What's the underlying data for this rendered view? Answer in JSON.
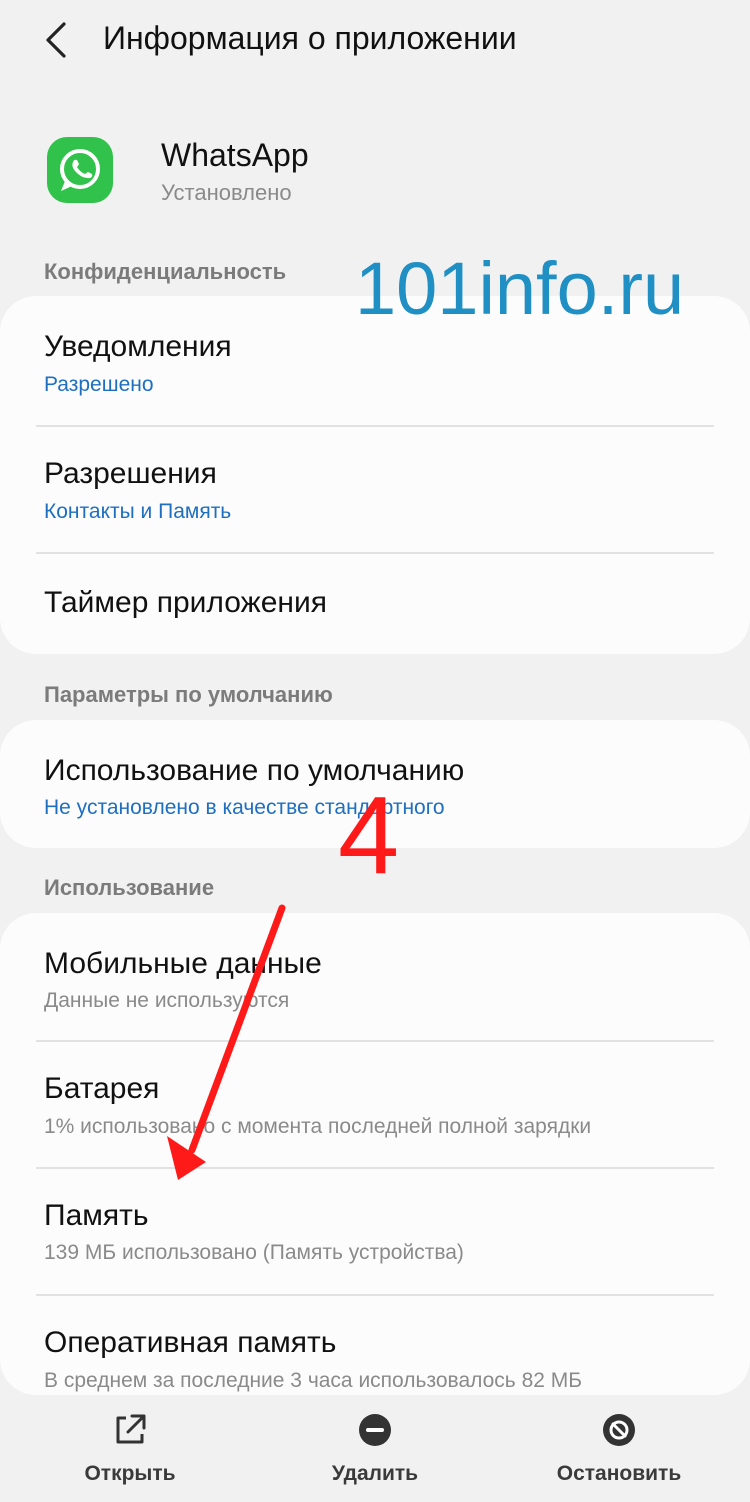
{
  "header": {
    "title": "Информация о приложении"
  },
  "app": {
    "name": "WhatsApp",
    "status": "Установлено"
  },
  "sections": {
    "privacy": "Конфиденциальность",
    "defaults": "Параметры по умолчанию",
    "usage": "Использование"
  },
  "privacy_items": [
    {
      "title": "Уведомления",
      "subtitle": "Разрешено"
    },
    {
      "title": "Разрешения",
      "subtitle": "Контакты и Память"
    },
    {
      "title": "Таймер приложения"
    }
  ],
  "defaults_items": [
    {
      "title": "Использование по умолчанию",
      "subtitle": "Не установлено в качестве стандартного"
    }
  ],
  "usage_items": [
    {
      "title": "Мобильные данные",
      "subtitle": "Данные не используются"
    },
    {
      "title": "Батарея",
      "subtitle": "1% использовано с момента последней полной зарядки"
    },
    {
      "title": "Память",
      "subtitle": "139 МБ использовано (Память устройства)"
    },
    {
      "title": "Оперативная память",
      "subtitle": "В среднем за последние 3 часа использовалось 82 МБ"
    }
  ],
  "bottom_bar": {
    "open": "Открыть",
    "delete": "Удалить",
    "stop": "Остановить"
  },
  "annotation": {
    "watermark": "101info.ru",
    "step": "4"
  },
  "colors": {
    "accent_blue": "#1f6fc0",
    "whatsapp_green": "#30c24a",
    "annotation_red": "#ff1a1a",
    "watermark_blue": "#1f8fc4"
  }
}
